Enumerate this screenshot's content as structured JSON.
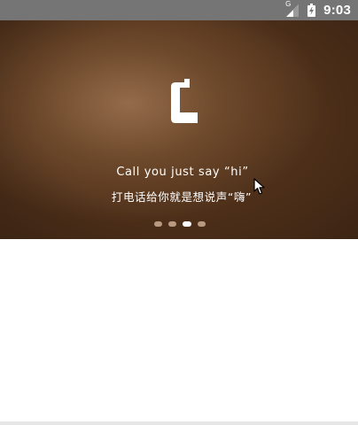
{
  "status_bar": {
    "time": "9:03",
    "network_type": "G",
    "icons": [
      "signal-icon",
      "battery-charging-icon"
    ]
  },
  "banner": {
    "logo_icon": "app-logo-c-icon",
    "tagline_english": "Call you just say “hi”",
    "tagline_chinese": "打电话给你就是想说声“嗨”",
    "page_indicator": {
      "count": 4,
      "active_index": 2
    },
    "colors": {
      "background_center": "#946c4b",
      "background_edge": "#4d2f19",
      "text": "#ffffff",
      "dot_inactive": "#b79a80",
      "dot_active": "#ffffff"
    }
  }
}
